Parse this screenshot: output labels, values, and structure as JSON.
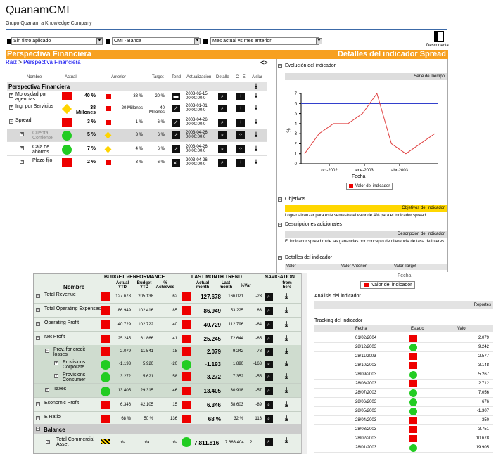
{
  "brand": {
    "title": "QuanamCMI",
    "subtitle": "Grupo Quanam a Knowledge Company"
  },
  "filters": {
    "f1": "Sin filtro aplicado",
    "f2": "CMI - Banca",
    "f3": "Mes actual vs mes anterior",
    "disconnect": "Desconecta"
  },
  "left": {
    "title": "Perspectiva Financiera",
    "crumb_root": "Raiz",
    "crumb_sep": " > ",
    "crumb_link": "Perspectiva Financiera",
    "nav": "<>",
    "headers": [
      "Nombre",
      "Actual",
      "Anterior",
      "Target",
      "Tend",
      "Actualizacion",
      "Detalle",
      "C - E",
      "Aislar"
    ],
    "section": "Perspectiva Financiera",
    "rows": [
      {
        "name": "Morosidad por agencias",
        "actual": "40 %",
        "prev": "38 %",
        "target": "20 %",
        "date": "2003-02-15 00:00:00.0"
      },
      {
        "name": "Ing. por Servicios",
        "actual": "38 Millones",
        "prev": "20 Millones",
        "target": "40 Millones",
        "date": "2003-01-01 00:00:00.0"
      },
      {
        "name": "Spread",
        "actual": "3 %",
        "prev": "1 %",
        "target": "6 %",
        "date": "2003-04-26 00:00:00.0"
      },
      {
        "name": "Cuenta Corriente",
        "actual": "5 %",
        "prev": "3 %",
        "target": "6 %",
        "date": "2003-04-26 00:00:00.0"
      },
      {
        "name": "Caja de ahorros",
        "actual": "7 %",
        "prev": "4 %",
        "target": "6 %",
        "date": "2003-04-26 00:00:00.0"
      },
      {
        "name": "Plazo fijo",
        "actual": "2 %",
        "prev": "3 %",
        "target": "6 %",
        "date": "2003-04-26 00:00:00.0"
      }
    ]
  },
  "right": {
    "title": "Detalles del indicador Spread",
    "evol": "Evolución del indicador",
    "serie": "Serie de Tiempo",
    "xlabel": "Fecha",
    "ylabel": "%",
    "legend": "Valor del indicador",
    "objetivos": "Objetivos",
    "obj_bar": "Objetivos del indicador",
    "obj_text": "Lograr alcanzar para este semestre el valor de 4% para el indicador spread",
    "desc": "Descripciones adicionales",
    "desc_bar": "Descripcion del indicador",
    "desc_text": "El indicador spread mide las ganancias por concepto de diferencia de tasa de interes",
    "detalles": "Detalles del indicador",
    "cols": [
      "Valor",
      "Valor Anterior",
      "Valor Target"
    ]
  },
  "chart_data": {
    "type": "line",
    "x": [
      "oct-2002",
      "ene-2003",
      "abr-2003"
    ],
    "ylim": [
      0,
      7
    ],
    "yticks": [
      "0",
      "1",
      "2",
      "3",
      "4",
      "5",
      "6",
      "7"
    ],
    "series": [
      {
        "name": "Valor del indicador",
        "values": [
          1,
          3,
          4,
          4,
          5,
          7,
          2,
          1,
          2,
          3
        ]
      }
    ],
    "target_line": 6,
    "xlabel": "Fecha",
    "ylabel": "%"
  },
  "bottom": {
    "h_budget": "BUDGET PERFORMANCE",
    "h_last": "LAST MONTH TREND",
    "h_nav": "NAVIGATION",
    "sub": [
      "Nombre",
      "Actual YTD",
      "Budget YTD",
      "% Achieved",
      "Actual month",
      "Last month",
      "%Var",
      "from here"
    ],
    "rows": [
      {
        "name": "Total Revenue",
        "a": "127.678",
        "b": "205.138",
        "p": "62",
        "am": "127.678",
        "lm": "166.021",
        "v": "-23"
      },
      {
        "name": "Total Operating Expenses",
        "a": "86.949",
        "b": "102.416",
        "p": "85",
        "am": "86.949",
        "lm": "53.225",
        "v": "63"
      },
      {
        "name": "Operating Profit",
        "a": "40.729",
        "b": "102.722",
        "p": "40",
        "am": "40.729",
        "lm": "112.796",
        "v": "-64"
      },
      {
        "name": "Net Profit",
        "a": "25.245",
        "b": "61.866",
        "p": "41",
        "am": "25.245",
        "lm": "72.644",
        "v": "-65"
      },
      {
        "name": "Prov. for credit losses",
        "a": "2.079",
        "b": "11.541",
        "p": "18",
        "am": "2.079",
        "lm": "9.242",
        "v": "-78"
      },
      {
        "name": "Provisions Corporate",
        "a": "-1.193",
        "b": "5.920",
        "p": "-20",
        "am": "-1.193",
        "lm": "1.890",
        "v": "-163"
      },
      {
        "name": "Provisions Consumer",
        "a": "3.272",
        "b": "5.621",
        "p": "58",
        "am": "3.272",
        "lm": "7.352",
        "v": "-55"
      },
      {
        "name": "Taxes",
        "a": "13.405",
        "b": "29.315",
        "p": "46",
        "am": "13.405",
        "lm": "30.918",
        "v": "-57"
      },
      {
        "name": "Economic Profit",
        "a": "6.346",
        "b": "42.105",
        "p": "15",
        "am": "6.346",
        "lm": "58.603",
        "v": "-89"
      },
      {
        "name": "E Ratio",
        "a": "68 %",
        "b": "50 %",
        "p": "136",
        "am": "68 %",
        "lm": "32 %",
        "v": "113"
      }
    ],
    "balance": "Balance",
    "tca": "Total Commercial Asset",
    "tca_a": "n/a",
    "tca_b": "n/a",
    "tca_p": "n/a",
    "tca_am": "7.811.816",
    "tca_lm": "7.663.404",
    "tca_v": "2"
  },
  "right2": {
    "fecha_hdr": "Fecha",
    "legend": "Valor del indicador",
    "analisis": "Análisis del indicador",
    "reportes": "Reportes",
    "tracking": "Tracking del indicador",
    "cols": [
      "Fecha",
      "Estado",
      "Valor"
    ],
    "rows": [
      {
        "f": "01/02/2004",
        "s": "red",
        "v": "2.079"
      },
      {
        "f": "28/12/2003",
        "s": "green",
        "v": "9.242"
      },
      {
        "f": "28/11/2003",
        "s": "red",
        "v": "2.577"
      },
      {
        "f": "28/10/2003",
        "s": "red",
        "v": "3.148"
      },
      {
        "f": "28/09/2003",
        "s": "green",
        "v": "5.267"
      },
      {
        "f": "28/08/2003",
        "s": "red",
        "v": "2.712"
      },
      {
        "f": "28/07/2003",
        "s": "green",
        "v": "7.056"
      },
      {
        "f": "28/06/2003",
        "s": "green",
        "v": "676"
      },
      {
        "f": "28/05/2003",
        "s": "green",
        "v": "-1.307"
      },
      {
        "f": "28/04/2003",
        "s": "red",
        "v": "-350"
      },
      {
        "f": "28/03/2003",
        "s": "red",
        "v": "3.751"
      },
      {
        "f": "28/02/2003",
        "s": "red",
        "v": "10.678"
      },
      {
        "f": "28/01/2003",
        "s": "green",
        "v": "19.905"
      }
    ]
  }
}
